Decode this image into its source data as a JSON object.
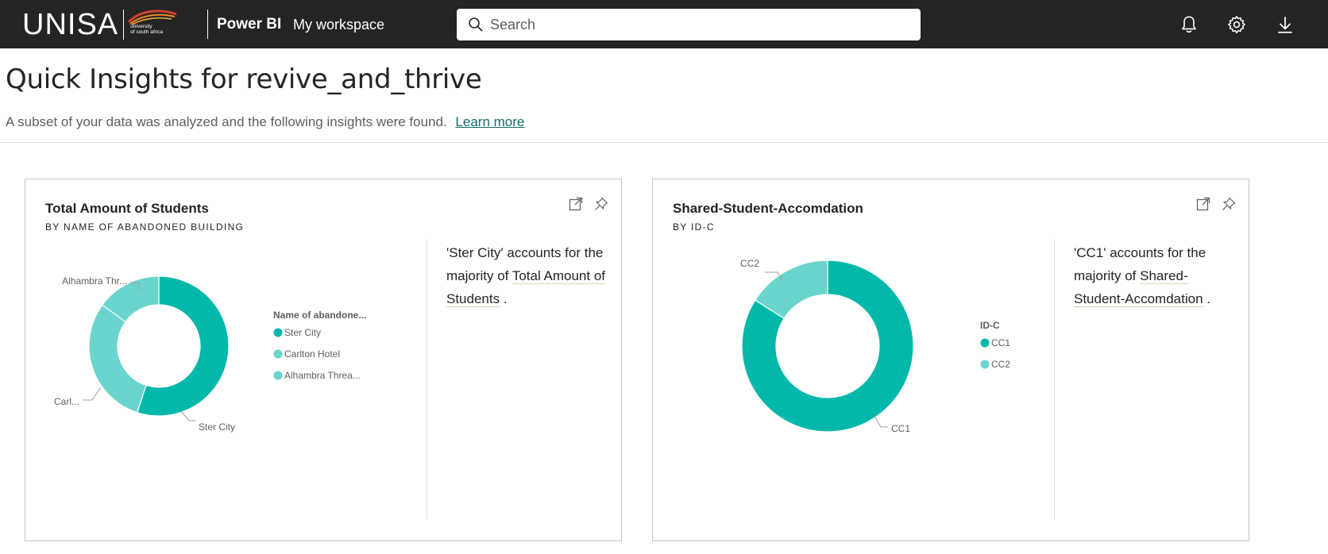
{
  "header": {
    "logo_text": "UNISA",
    "logo_subtext_line1": "university",
    "logo_subtext_line2": "of south africa",
    "app_name": "Power BI",
    "workspace": "My workspace",
    "search_placeholder": "Search",
    "icons": [
      "bell-icon",
      "gear-icon",
      "download-icon"
    ]
  },
  "page": {
    "title": "Quick Insights for revive_and_thrive",
    "subtitle": "A subset of your data was analyzed and the following insights were found.",
    "learn_more": "Learn more"
  },
  "colors": {
    "topbar": "#252423",
    "teal_dark": "#01b8aa",
    "teal_light": "#6ad5cc",
    "link": "#0f6e6a"
  },
  "cards": [
    {
      "title": "Total Amount of Students",
      "subtitle": "BY NAME OF ABANDONED BUILDING",
      "insight_pre": "'Ster City' accounts for the majority of ",
      "insight_highlight": "Total Amount of Students",
      "insight_post": " .",
      "chart_data": {
        "type": "pie",
        "variant": "donut",
        "legend_title": "Name of abandone...",
        "slices": [
          {
            "label": "Ster City",
            "legend_label": "Ster City",
            "data_label": "Ster City",
            "value": 55,
            "color": "#01b8aa"
          },
          {
            "label": "Carlton Hotel",
            "legend_label": "Carlton Hotel",
            "data_label": "Carl...",
            "value": 30,
            "color": "#6ad5cc"
          },
          {
            "label": "Alhambra Theatre",
            "legend_label": "Alhambra Threa...",
            "data_label": "Alhambra Thr...",
            "value": 15,
            "color": "#6ad5cc"
          }
        ]
      }
    },
    {
      "title": "Shared-Student-Accomdation",
      "subtitle": "BY ID-C",
      "insight_pre": "'CC1' accounts for the majority of ",
      "insight_highlight": "Shared-Student-Accomdation",
      "insight_post": " .",
      "chart_data": {
        "type": "pie",
        "variant": "donut",
        "legend_title": "ID-C",
        "slices": [
          {
            "label": "CC1",
            "legend_label": "CC1",
            "data_label": "CC1",
            "value": 84,
            "color": "#01b8aa"
          },
          {
            "label": "CC2",
            "legend_label": "CC2",
            "data_label": "CC2",
            "value": 16,
            "color": "#6ad5cc"
          }
        ]
      }
    }
  ]
}
